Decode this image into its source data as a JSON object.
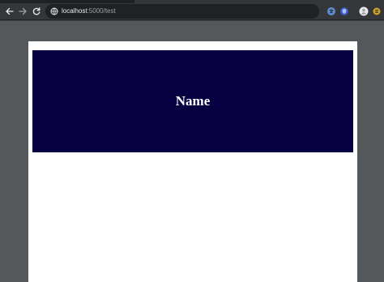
{
  "browser": {
    "address_bar": {
      "host": "localhost",
      "path": ":5000/test"
    }
  },
  "page": {
    "header": {
      "title": "Name",
      "background_color": "#060040"
    }
  }
}
